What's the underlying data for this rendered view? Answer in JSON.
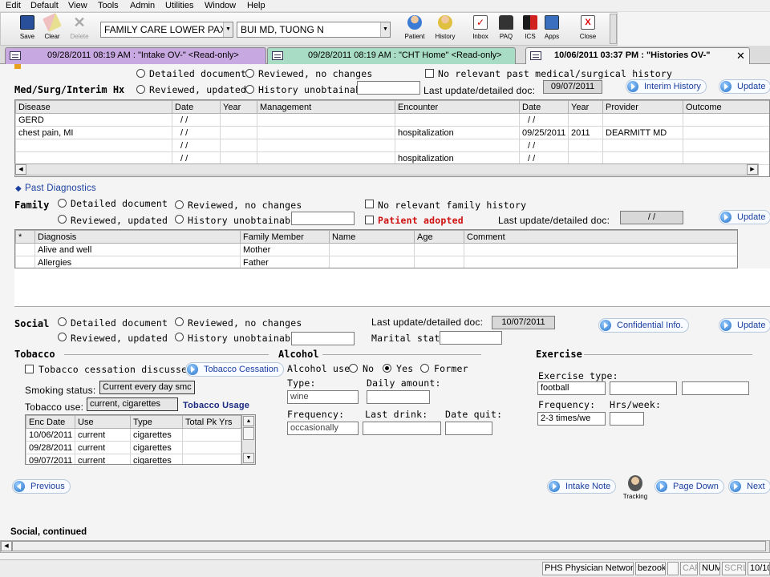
{
  "menu": [
    "Edit",
    "Default",
    "View",
    "Tools",
    "Admin",
    "Utilities",
    "Window",
    "Help"
  ],
  "toolbar": {
    "save": "Save",
    "clear": "Clear",
    "delete": "Delete",
    "location": "FAMILY CARE LOWER PAX",
    "provider": "BUI MD, TUONG  N",
    "patient": "Patient",
    "history": "History",
    "inbox": "Inbox",
    "paq": "PAQ",
    "ics": "ICS",
    "apps": "Apps",
    "close": "Close"
  },
  "tabs": [
    {
      "label": "09/28/2011 08:19 AM : \"Intake OV-\" <Read-only>",
      "color": "#c8a8e0"
    },
    {
      "label": "09/28/2011 08:19 AM : \"CHT Home\" <Read-only>",
      "color": "#a8dcc4"
    },
    {
      "label": "10/06/2011 03:37 PM : \"Histories OV-\"",
      "color": "#f4f4f4"
    }
  ],
  "medsurg": {
    "detailed": "Detailed document",
    "reviewed_no": "Reviewed, no changes",
    "no_relevant": "No relevant past medical/surgical history",
    "title": "Med/Surg/Interim Hx",
    "reviewed_up": "Reviewed, updated",
    "unobtainable": "History unobtainable:",
    "last_update": "Last update/detailed doc:",
    "last_date": "09/07/2011",
    "interim_btn": "Interim History",
    "update_btn": "Update",
    "columns": [
      "Disease",
      "Date",
      "Year",
      "Management",
      "Encounter",
      "Date",
      "Year",
      "Provider",
      "Outcome"
    ],
    "rows": [
      [
        "GERD",
        "/ /",
        "",
        "",
        "",
        "/ /",
        "",
        "",
        ""
      ],
      [
        "chest pain, MI",
        "/ /",
        "",
        "",
        "hospitalization",
        "09/25/2011",
        "2011",
        "DEARMITT MD",
        ""
      ],
      [
        "",
        "/ /",
        "",
        "",
        "",
        "/ /",
        "",
        "",
        ""
      ],
      [
        "",
        "/ /",
        "",
        "",
        "hospitalization",
        "/ /",
        "",
        "",
        ""
      ]
    ]
  },
  "past_diag": "Past Diagnostics",
  "family": {
    "title": "Family",
    "detailed": "Detailed document",
    "reviewed_no": "Reviewed, no changes",
    "no_relevant": "No relevant family history",
    "reviewed_up": "Reviewed, updated",
    "unobtainable": "History unobtainable:",
    "adopted": "Patient adopted",
    "last_update": "Last update/detailed doc:",
    "last_date": "/ /",
    "update_btn": "Update",
    "columns": [
      "*",
      "Diagnosis",
      "Family Member",
      "Name",
      "Age",
      "Comment"
    ],
    "rows": [
      [
        "",
        "Alive and well",
        "Mother",
        "",
        "",
        ""
      ],
      [
        "",
        "Allergies",
        "Father",
        "",
        "",
        ""
      ]
    ]
  },
  "social": {
    "title": "Social",
    "detailed": "Detailed document",
    "reviewed_no": "Reviewed, no changes",
    "reviewed_up": "Reviewed, updated",
    "unobtainable": "History unobtainable:",
    "last_update": "Last update/detailed doc:",
    "last_date": "10/07/2011",
    "marital": "Marital status:",
    "confidential_btn": "Confidential Info.",
    "update_btn": "Update"
  },
  "tobacco": {
    "title": "Tobacco",
    "cessation_discussed": "Tobacco cessation discussed",
    "cessation_btn": "Tobacco Cessation",
    "smoking_label": "Smoking status:",
    "smoking_value": "Current every day smc",
    "use_label": "Tobacco use:",
    "use_value": "current, cigarettes",
    "usage_link": "Tobacco Usage",
    "columns": [
      "Enc Date",
      "Use",
      "Type",
      "Total Pk Yrs"
    ],
    "rows": [
      [
        "10/06/2011",
        "current",
        "cigarettes",
        ""
      ],
      [
        "09/28/2011",
        "current",
        "cigarettes",
        ""
      ],
      [
        "09/07/2011",
        "current",
        "cigarettes",
        ""
      ]
    ]
  },
  "alcohol": {
    "title": "Alcohol",
    "use_label": "Alcohol use:",
    "no": "No",
    "yes": "Yes",
    "former": "Former",
    "type_label": "Type:",
    "type_value": "wine",
    "daily_label": "Daily amount:",
    "daily_value": "",
    "freq_label": "Frequency:",
    "freq_value": "occasionally",
    "last_label": "Last drink:",
    "quit_label": "Date quit:"
  },
  "exercise": {
    "title": "Exercise",
    "type_label": "Exercise type:",
    "type_value": "football",
    "freq_label": "Frequency:",
    "freq_value": "2-3 times/we",
    "hrs_label": "Hrs/week:"
  },
  "nav": {
    "previous": "Previous",
    "intake_note": "Intake Note",
    "tracking": "Tracking",
    "page_down": "Page Down",
    "next": "Next"
  },
  "continued": "Social, continued",
  "status": {
    "network": "PHS Physician Network",
    "user": "bezook",
    "caps": "CAP",
    "num": "NUM",
    "scrl": "SCRL",
    "date": "10/10"
  }
}
